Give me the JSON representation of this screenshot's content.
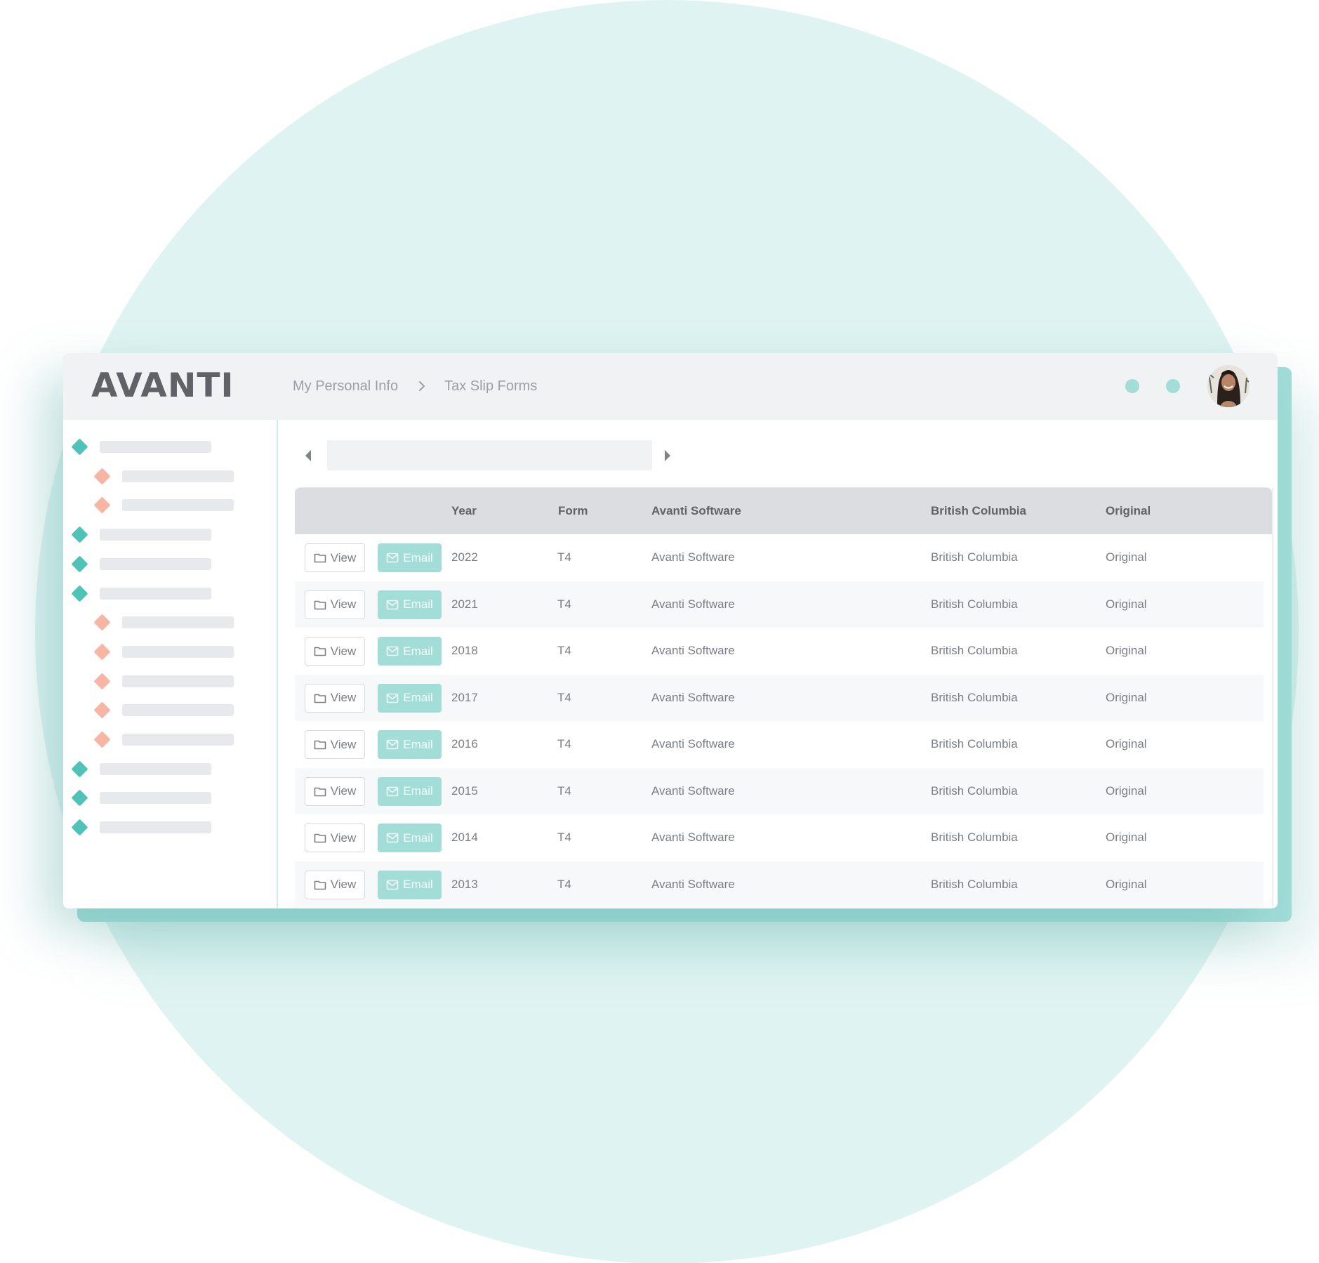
{
  "brand": {
    "logo_text": "AVANTI",
    "accent_color": "#a2ddd8",
    "sidebar_primary_color": "#4fc4b6",
    "sidebar_secondary_color": "#f7b5a3",
    "background_circle_color": "#dff4f2"
  },
  "header": {
    "breadcrumb": [
      {
        "label": "My Personal Info"
      },
      {
        "label": "Tax Slip Forms"
      }
    ],
    "separator_icon": "chevron-right-icon",
    "status_dots": [
      "dot",
      "dot"
    ],
    "avatar_icon": "user-avatar"
  },
  "sidebar": {
    "items": [
      {
        "level": 1,
        "icon": "diamond-teal-icon"
      },
      {
        "level": 2,
        "icon": "diamond-salmon-icon"
      },
      {
        "level": 2,
        "icon": "diamond-salmon-icon"
      },
      {
        "level": 1,
        "icon": "diamond-teal-icon"
      },
      {
        "level": 1,
        "icon": "diamond-teal-icon"
      },
      {
        "level": 1,
        "icon": "diamond-teal-icon"
      },
      {
        "level": 2,
        "icon": "diamond-salmon-icon"
      },
      {
        "level": 2,
        "icon": "diamond-salmon-icon"
      },
      {
        "level": 2,
        "icon": "diamond-salmon-icon"
      },
      {
        "level": 2,
        "icon": "diamond-salmon-icon"
      },
      {
        "level": 2,
        "icon": "diamond-salmon-icon"
      },
      {
        "level": 1,
        "icon": "diamond-teal-icon"
      },
      {
        "level": 1,
        "icon": "diamond-teal-icon"
      },
      {
        "level": 1,
        "icon": "diamond-teal-icon"
      }
    ]
  },
  "pager": {
    "prev_icon": "caret-left-icon",
    "next_icon": "caret-right-icon"
  },
  "table": {
    "columns": [
      "Year",
      "Form",
      "Avanti Software",
      "British Columbia",
      "Original"
    ],
    "actions": {
      "view_label": "View",
      "view_icon": "folder-icon",
      "email_label": "Email",
      "email_icon": "envelope-icon"
    },
    "rows": [
      {
        "year": "2022",
        "form": "T4",
        "issuer": "Avanti Software",
        "province": "British Columbia",
        "type": "Original"
      },
      {
        "year": "2021",
        "form": "T4",
        "issuer": "Avanti Software",
        "province": "British Columbia",
        "type": "Original"
      },
      {
        "year": "2018",
        "form": "T4",
        "issuer": "Avanti Software",
        "province": "British Columbia",
        "type": "Original"
      },
      {
        "year": "2017",
        "form": "T4",
        "issuer": "Avanti Software",
        "province": "British Columbia",
        "type": "Original"
      },
      {
        "year": "2016",
        "form": "T4",
        "issuer": "Avanti Software",
        "province": "British Columbia",
        "type": "Original"
      },
      {
        "year": "2015",
        "form": "T4",
        "issuer": "Avanti Software",
        "province": "British Columbia",
        "type": "Original"
      },
      {
        "year": "2014",
        "form": "T4",
        "issuer": "Avanti Software",
        "province": "British Columbia",
        "type": "Original"
      },
      {
        "year": "2013",
        "form": "T4",
        "issuer": "Avanti Software",
        "province": "British Columbia",
        "type": "Original"
      }
    ]
  }
}
